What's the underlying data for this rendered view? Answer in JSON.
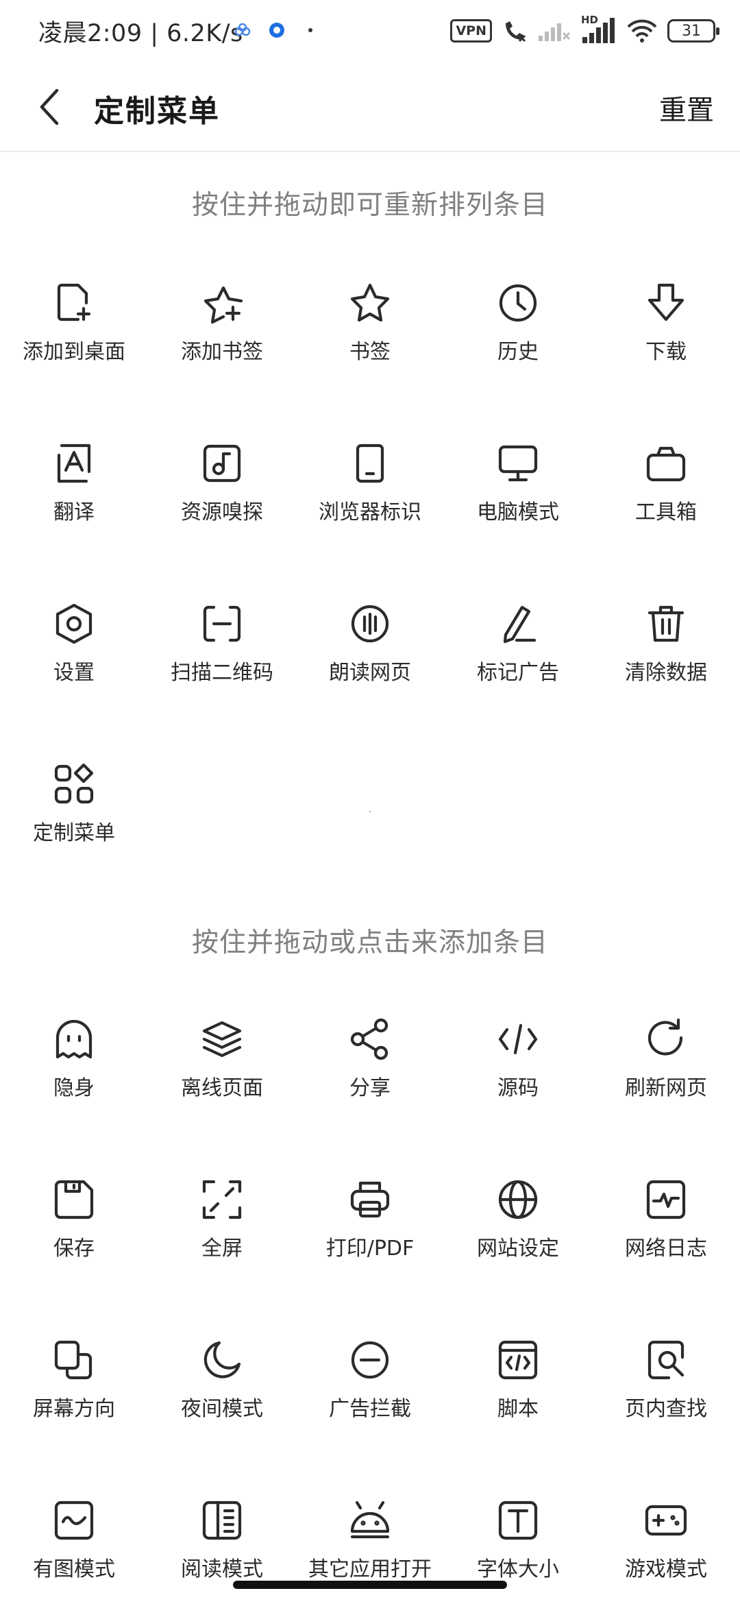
{
  "status_bar": {
    "time_speed": "凌晨2:09 | 6.2K/s",
    "vpn_label": "VPN",
    "hd_label": "HD",
    "battery": "31"
  },
  "header": {
    "title": "定制菜单",
    "reset_label": "重置"
  },
  "active_section": {
    "hint": "按住并拖动即可重新排列条目",
    "items": [
      {
        "label": "添加到桌面",
        "icon": "add-to-desktop-icon"
      },
      {
        "label": "添加书签",
        "icon": "add-bookmark-icon"
      },
      {
        "label": "书签",
        "icon": "bookmark-star-icon"
      },
      {
        "label": "历史",
        "icon": "history-clock-icon"
      },
      {
        "label": "下载",
        "icon": "download-icon"
      },
      {
        "label": "翻译",
        "icon": "translate-icon"
      },
      {
        "label": "资源嗅探",
        "icon": "media-sniff-icon"
      },
      {
        "label": "浏览器标识",
        "icon": "user-agent-phone-icon"
      },
      {
        "label": "电脑模式",
        "icon": "desktop-mode-icon"
      },
      {
        "label": "工具箱",
        "icon": "toolbox-icon"
      },
      {
        "label": "设置",
        "icon": "settings-hexagon-icon"
      },
      {
        "label": "扫描二维码",
        "icon": "scan-qr-icon"
      },
      {
        "label": "朗读网页",
        "icon": "read-aloud-icon"
      },
      {
        "label": "标记广告",
        "icon": "mark-ad-pen-icon"
      },
      {
        "label": "清除数据",
        "icon": "clear-data-trash-icon"
      },
      {
        "label": "定制菜单",
        "icon": "customize-menu-icon"
      }
    ]
  },
  "available_section": {
    "hint": "按住并拖动或点击来添加条目",
    "items": [
      {
        "label": "隐身",
        "icon": "incognito-ghost-icon"
      },
      {
        "label": "离线页面",
        "icon": "offline-pages-layers-icon"
      },
      {
        "label": "分享",
        "icon": "share-icon"
      },
      {
        "label": "源码",
        "icon": "source-code-icon"
      },
      {
        "label": "刷新网页",
        "icon": "refresh-icon"
      },
      {
        "label": "保存",
        "icon": "save-floppy-icon"
      },
      {
        "label": "全屏",
        "icon": "fullscreen-icon"
      },
      {
        "label": "打印/PDF",
        "icon": "print-icon"
      },
      {
        "label": "网站设定",
        "icon": "site-settings-globe-icon"
      },
      {
        "label": "网络日志",
        "icon": "network-log-icon"
      },
      {
        "label": "屏幕方向",
        "icon": "screen-rotation-icon"
      },
      {
        "label": "夜间模式",
        "icon": "night-mode-moon-icon"
      },
      {
        "label": "广告拦截",
        "icon": "ad-block-icon"
      },
      {
        "label": "脚本",
        "icon": "script-icon"
      },
      {
        "label": "页内查找",
        "icon": "find-in-page-icon"
      },
      {
        "label": "有图模式",
        "icon": "image-mode-icon"
      },
      {
        "label": "阅读模式",
        "icon": "reader-mode-icon"
      },
      {
        "label": "其它应用打开",
        "icon": "open-in-other-app-android-icon"
      },
      {
        "label": "字体大小",
        "icon": "font-size-icon"
      },
      {
        "label": "游戏模式",
        "icon": "game-mode-gamepad-icon"
      }
    ]
  }
}
